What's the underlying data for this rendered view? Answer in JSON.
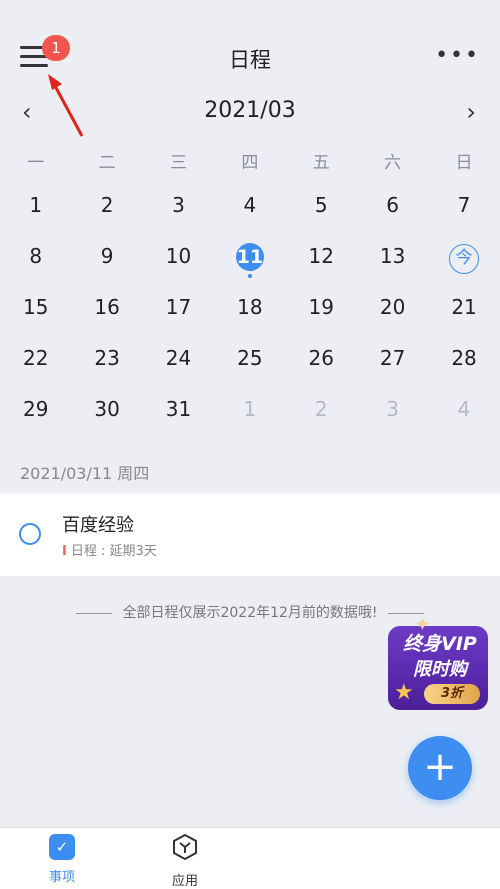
{
  "header": {
    "title": "日程",
    "badge_count": "1",
    "more_label": "•••"
  },
  "calendar": {
    "month_label": "2021/03",
    "prev_label": "‹",
    "next_label": "›",
    "weekdays": [
      "一",
      "二",
      "三",
      "四",
      "五",
      "六",
      "日"
    ],
    "weeks": [
      [
        "1",
        "2",
        "3",
        "4",
        "5",
        "6",
        "7"
      ],
      [
        "8",
        "9",
        "10",
        "11",
        "12",
        "13",
        "今"
      ],
      [
        "15",
        "16",
        "17",
        "18",
        "19",
        "20",
        "21"
      ],
      [
        "22",
        "23",
        "24",
        "25",
        "26",
        "27",
        "28"
      ],
      [
        "29",
        "30",
        "31",
        "1",
        "2",
        "3",
        "4"
      ]
    ],
    "selected_day": "11",
    "today_marker": "今"
  },
  "selected_date": {
    "label": "2021/03/11 周四"
  },
  "event": {
    "title": "百度经验",
    "subtitle_marker": "I",
    "subtitle": "日程 : 延期3天"
  },
  "notice": {
    "text": "全部日程仅展示2022年12月前的数据哦!"
  },
  "vip": {
    "line1": "终身VIP",
    "line2": "限时购",
    "discount": "3折"
  },
  "fab": {
    "label": "+"
  },
  "tabbar": {
    "tabs": [
      {
        "label": "事项",
        "icon_glyph": "✓"
      },
      {
        "label": "应用",
        "icon_glyph": "Y"
      }
    ]
  },
  "colors": {
    "accent": "#3d8ef0",
    "badge": "#f0554f",
    "vip_purple": "#5a2bb0"
  }
}
